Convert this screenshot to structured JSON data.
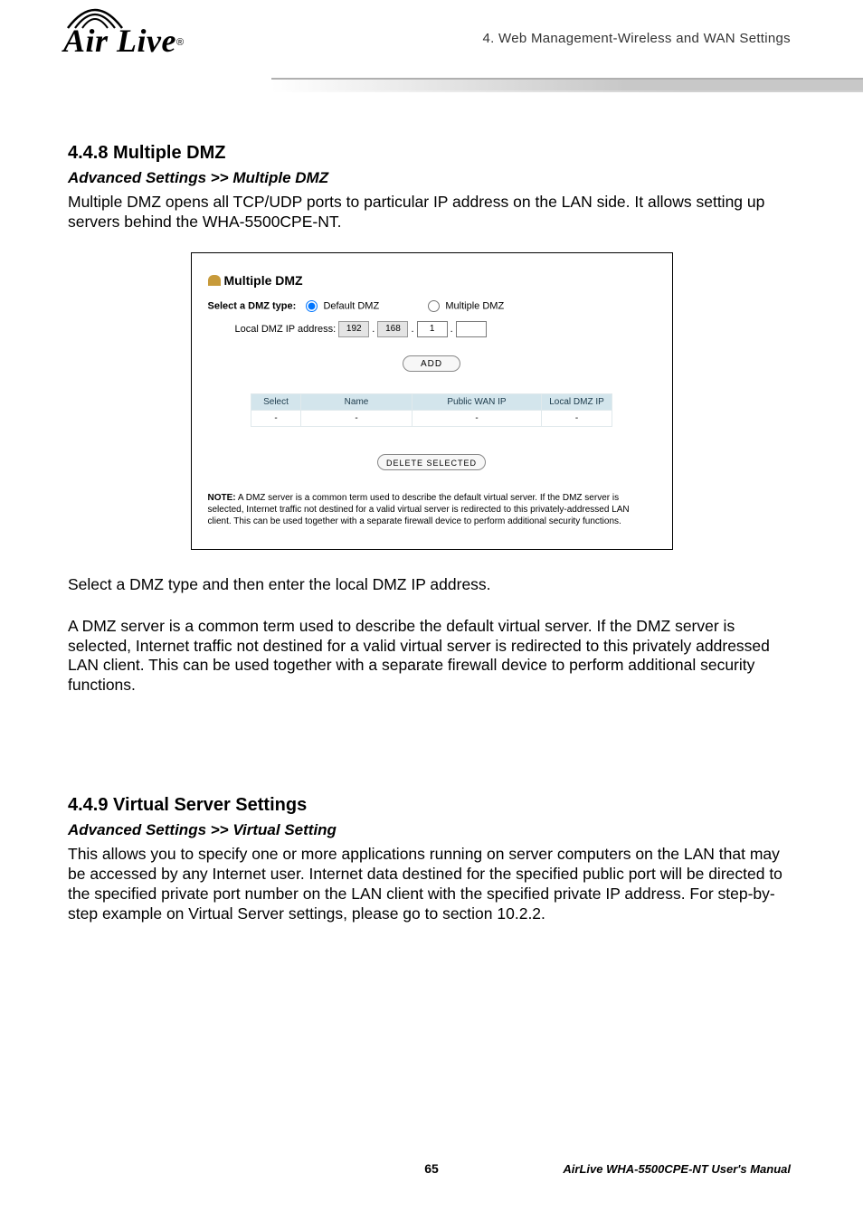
{
  "header": {
    "chapter_label": "4. Web Management-Wireless and WAN Settings",
    "brand": "Air Live",
    "brand_reg": "®"
  },
  "section1": {
    "number_title": "4.4.8 Multiple DMZ",
    "breadcrumb": "Advanced Settings >> Multiple DMZ",
    "intro": "Multiple DMZ opens all TCP/UDP ports to particular IP address on the LAN side.   It allows setting up servers behind the WHA-5500CPE-NT.",
    "after1": "Select a DMZ type and then enter the local DMZ IP address.",
    "after2": "A DMZ server is a common term used to describe the default virtual server. If the DMZ server is selected, Internet traffic not destined for a valid virtual server is redirected to this privately addressed LAN client. This can be used together with a separate firewall device to perform additional security functions."
  },
  "screenshot": {
    "title": "Multiple DMZ",
    "type_label": "Select a DMZ type:",
    "option_default": "Default DMZ",
    "option_multiple": "Multiple DMZ",
    "ip_label": "Local DMZ IP address:",
    "ip_octets": [
      "192",
      "168",
      "1",
      ""
    ],
    "add_btn": "ADD",
    "th_select": "Select",
    "th_name": "Name",
    "th_public": "Public WAN IP",
    "th_local": "Local DMZ IP",
    "cell_empty": "-",
    "delete_btn": "DELETE SELECTED",
    "note_bold": "NOTE:",
    "note_text": " A DMZ server is a common term used to describe the default virtual server. If the DMZ server is selected, Internet traffic not destined for a valid virtual server is redirected to this privately-addressed LAN client. This can be used together with a separate firewall device to perform additional security functions."
  },
  "section2": {
    "number_title": "4.4.9 Virtual Server Settings",
    "breadcrumb": "Advanced Settings >> Virtual Setting",
    "body": "This allows you to specify one or more applications running on server computers on the LAN that may be accessed by any Internet user. Internet data destined for the specified public port will be directed to the specified private port number on the LAN client with the specified private IP address.   For step-by-step example on Virtual Server settings, please go to section 10.2.2."
  },
  "footer": {
    "page": "65",
    "manual": "AirLive WHA-5500CPE-NT User's Manual"
  }
}
